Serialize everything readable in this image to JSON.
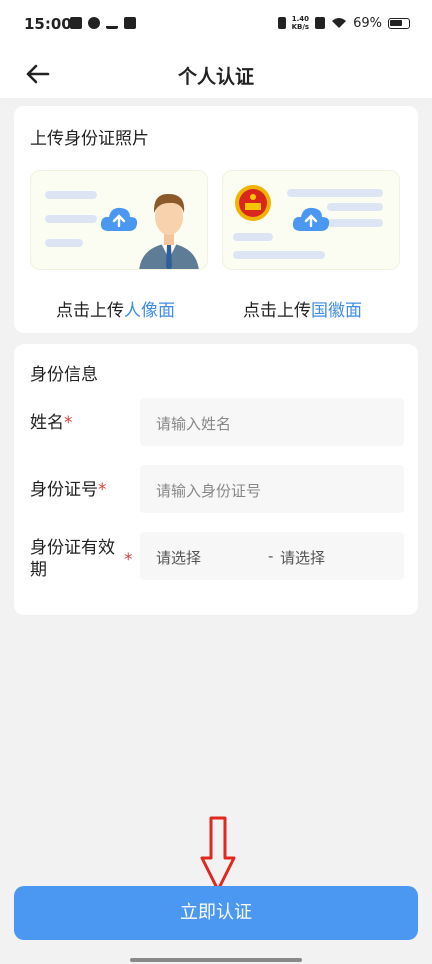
{
  "status": {
    "time": "15:00",
    "net_speed_value": "1.40",
    "net_speed_unit": "KB/s",
    "battery": "69%"
  },
  "nav": {
    "title": "个人认证"
  },
  "upload": {
    "title": "上传身份证照片",
    "portrait_prefix": "点击上传",
    "portrait_highlight": "人像面",
    "emblem_prefix": "点击上传",
    "emblem_highlight": "国徽面"
  },
  "info": {
    "title": "身份信息",
    "name_label": "姓名",
    "name_placeholder": "请输入姓名",
    "id_label": "身份证号",
    "id_placeholder": "请输入身份证号",
    "validity_label_line1": "身份证有效",
    "validity_label_line2": "期",
    "validity_start": "请选择",
    "validity_separator": "-",
    "validity_end": "请选择",
    "required_mark": "*"
  },
  "submit_label": "立即认证",
  "colors": {
    "accent": "#4b98f2",
    "highlight": "#3f8ee8",
    "required": "#e0403e",
    "annotation": "#e0281e"
  }
}
